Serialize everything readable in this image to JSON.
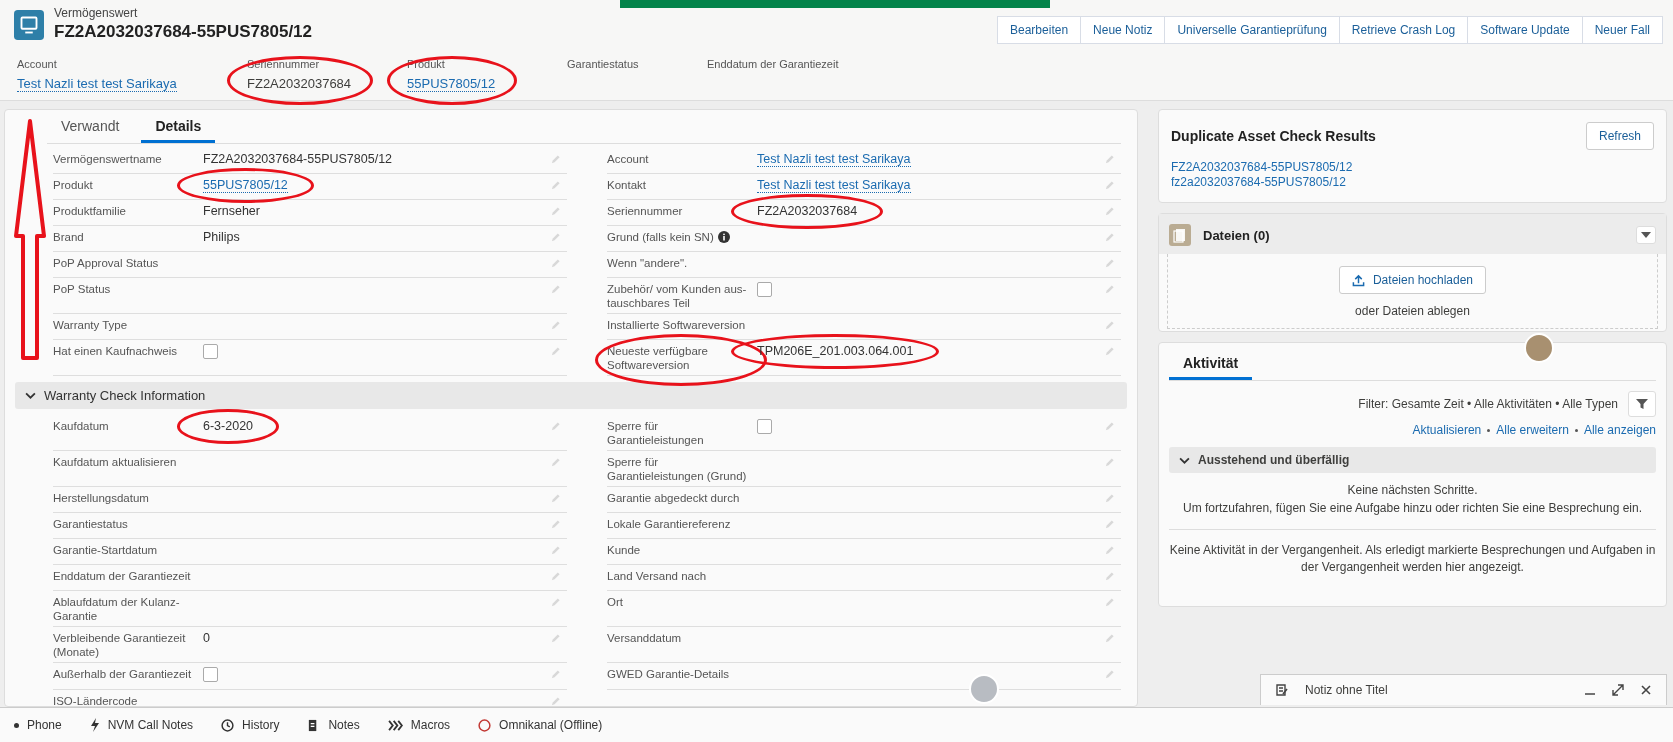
{
  "header": {
    "object_type": "Vermögenswert",
    "title": "FZ2A2032037684-55PUS7805/12",
    "actions": [
      "Bearbeiten",
      "Neue Notiz",
      "Universelle Garantieprüfung",
      "Retrieve Crash Log",
      "Software Update",
      "Neuer Fall"
    ]
  },
  "highlights": [
    {
      "label": "Account",
      "kind": "link",
      "value": "Test Nazli test test Sarikaya"
    },
    {
      "label": "Seriennummer",
      "kind": "text",
      "value": "FZ2A2032037684",
      "circled": true
    },
    {
      "label": "Produkt",
      "kind": "link",
      "value": "55PUS7805/12",
      "circled": true
    },
    {
      "label": "Garantiestatus",
      "kind": "empty"
    },
    {
      "label": "Enddatum der Garantiezeit",
      "kind": "empty"
    }
  ],
  "tabs": [
    {
      "label": "Verwandt",
      "selected": false
    },
    {
      "label": "Details",
      "selected": true
    }
  ],
  "sections": [
    {
      "rows": [
        {
          "left": {
            "label": "Vermögenswertname",
            "kind": "text",
            "value": "FZ2A2032037684-55PUS7805/12"
          },
          "right": {
            "label": "Account",
            "kind": "link",
            "value": "Test Nazli test test Sarikaya"
          }
        },
        {
          "left": {
            "label": "Produkt",
            "kind": "link",
            "value": "55PUS7805/12",
            "circled": true
          },
          "right": {
            "label": "Kontakt",
            "kind": "link",
            "value": "Test Nazli test test Sarikaya"
          }
        },
        {
          "left": {
            "label": "Produktfamilie",
            "kind": "text",
            "value": "Fernseher"
          },
          "right": {
            "label": "Seriennummer",
            "kind": "text",
            "value": "FZ2A2032037684",
            "circled": true
          }
        },
        {
          "left": {
            "label": "Brand",
            "kind": "text",
            "value": "Philips"
          },
          "right": {
            "label": "Grund (falls kein SN)",
            "kind": "empty",
            "info": true
          }
        },
        {
          "left": {
            "label": "PoP Approval Status",
            "kind": "empty"
          },
          "right": {
            "label": "Wenn \"andere\".",
            "kind": "empty"
          }
        },
        {
          "left": {
            "label": "PoP Status",
            "kind": "empty"
          },
          "right": {
            "label": "Zubehör/ vom Kunden aus-tauschbares Teil",
            "kind": "checkbox",
            "checked": false
          }
        },
        {
          "left": {
            "label": "Warranty Type",
            "kind": "empty"
          },
          "right": {
            "label": "Installierte Softwareversion",
            "kind": "empty"
          }
        },
        {
          "left": {
            "label": "Hat einen Kaufnachweis",
            "kind": "checkbox",
            "checked": false
          },
          "right": {
            "label": "Neueste verfügbare Softwareversion",
            "kind": "text",
            "value": "TPM206E_201.003.064.001",
            "circled": true,
            "label_circled": true
          }
        }
      ]
    },
    {
      "title": "Warranty Check Information",
      "expanded": true,
      "rows": [
        {
          "left": {
            "label": "Kaufdatum",
            "kind": "text",
            "value": "6-3-2020",
            "circled": true
          },
          "right": {
            "label": "Sperre für Garantieleistungen",
            "kind": "checkbox",
            "checked": false
          }
        },
        {
          "left": {
            "label": "Kaufdatum aktualisieren",
            "kind": "empty"
          },
          "right": {
            "label": "Sperre für Garantieleistungen (Grund)",
            "kind": "empty"
          }
        },
        {
          "left": {
            "label": "Herstellungsdatum",
            "kind": "empty"
          },
          "right": {
            "label": "Garantie abgedeckt durch",
            "kind": "empty"
          }
        },
        {
          "left": {
            "label": "Garantiestatus",
            "kind": "empty"
          },
          "right": {
            "label": "Lokale Garantiereferenz",
            "kind": "empty"
          }
        },
        {
          "left": {
            "label": "Garantie-Startdatum",
            "kind": "empty"
          },
          "right": {
            "label": "Kunde",
            "kind": "empty"
          }
        },
        {
          "left": {
            "label": "Enddatum der Garantiezeit",
            "kind": "empty"
          },
          "right": {
            "label": "Land Versand nach",
            "kind": "empty"
          }
        },
        {
          "left": {
            "label": "Ablaufdatum der Kulanz-Garantie",
            "kind": "empty"
          },
          "right": {
            "label": "Ort",
            "kind": "empty"
          }
        },
        {
          "left": {
            "label": "Verbleibende Garantiezeit (Monate)",
            "kind": "text",
            "value": "0"
          },
          "right": {
            "label": "Versanddatum",
            "kind": "empty"
          }
        },
        {
          "left": {
            "label": "Außerhalb der Garantiezeit",
            "kind": "checkbox",
            "checked": false
          },
          "right": {
            "label": "GWED Garantie-Details",
            "kind": "empty"
          }
        },
        {
          "left": {
            "label": "ISO-Ländercode",
            "kind": "empty"
          }
        }
      ]
    }
  ],
  "duplicate_check": {
    "title": "Duplicate Asset Check Results",
    "button": "Refresh",
    "links": [
      "FZ2A2032037684-55PUS7805/12",
      "fz2a2032037684-55PUS7805/12"
    ]
  },
  "files": {
    "title": "Dateien (0)",
    "upload_button": "Dateien hochladen",
    "drop_hint": "oder Dateien ablegen"
  },
  "activity": {
    "tabs": [
      {
        "label": "Aktivität",
        "selected": true
      }
    ],
    "filter": "Filter: Gesamte Zeit • Alle Aktivitäten • Alle Typen",
    "actions": [
      "Aktualisieren",
      "Alle erweitern",
      "Alle anzeigen"
    ],
    "group": {
      "title": "Ausstehend und überfällig",
      "expanded": true
    },
    "next_steps": [
      "Keine nächsten Schritte.",
      "Um fortzufahren, fügen Sie eine Aufgabe hinzu oder richten Sie eine Besprechung ein."
    ],
    "past": "Keine Aktivität in der Vergangenheit. Als erledigt markierte Besprechungen und Aufgaben in der Vergangenheit werden hier angezeigt."
  },
  "utility_bar": [
    {
      "kind": "phone",
      "label": "Phone"
    },
    {
      "kind": "bolt",
      "label": "NVM Call Notes"
    },
    {
      "kind": "clock",
      "label": "History"
    },
    {
      "kind": "note",
      "label": "Notes"
    },
    {
      "kind": "macro",
      "label": "Macros"
    },
    {
      "kind": "status",
      "label": "Omnikanal (Offline)"
    }
  ],
  "note_panel": {
    "title": "Notiz ohne Titel"
  }
}
